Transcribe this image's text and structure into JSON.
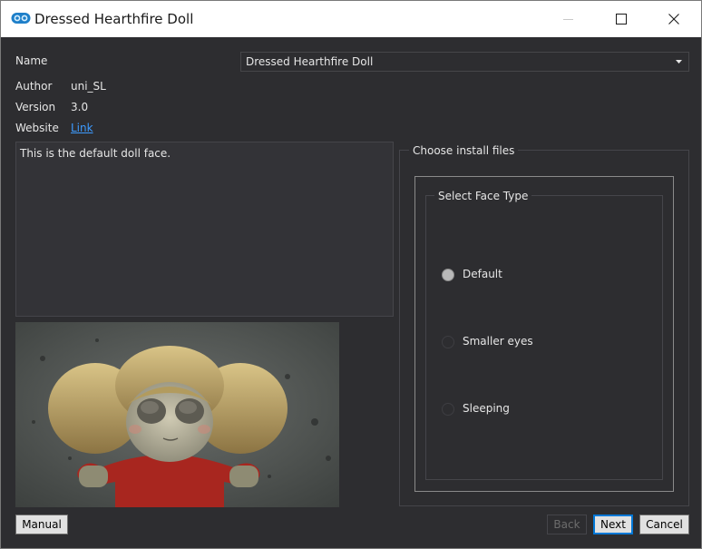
{
  "window": {
    "title": "Dressed Hearthfire Doll",
    "icon": "mod-organizer-icon",
    "controls": {
      "minimize": "minimize-icon",
      "maximize": "maximize-icon",
      "close": "close-icon"
    }
  },
  "info": {
    "name_label": "Name",
    "name_value": "Dressed Hearthfire Doll",
    "author_label": "Author",
    "author_value": "uni_SL",
    "version_label": "Version",
    "version_value": "3.0",
    "website_label": "Website",
    "website_link": "Link"
  },
  "description": "This is the default doll face.",
  "install": {
    "title": "Choose install files",
    "group_title": "Select Face Type",
    "options": [
      {
        "label": "Default",
        "checked": true
      },
      {
        "label": "Smaller eyes",
        "checked": false
      },
      {
        "label": "Sleeping",
        "checked": false
      }
    ]
  },
  "buttons": {
    "manual": "Manual",
    "back": "Back",
    "next": "Next",
    "cancel": "Cancel"
  },
  "colors": {
    "background": "#2d2d30",
    "text": "#e6e6e6",
    "link": "#3d9bff",
    "accent": "#0078d7"
  }
}
